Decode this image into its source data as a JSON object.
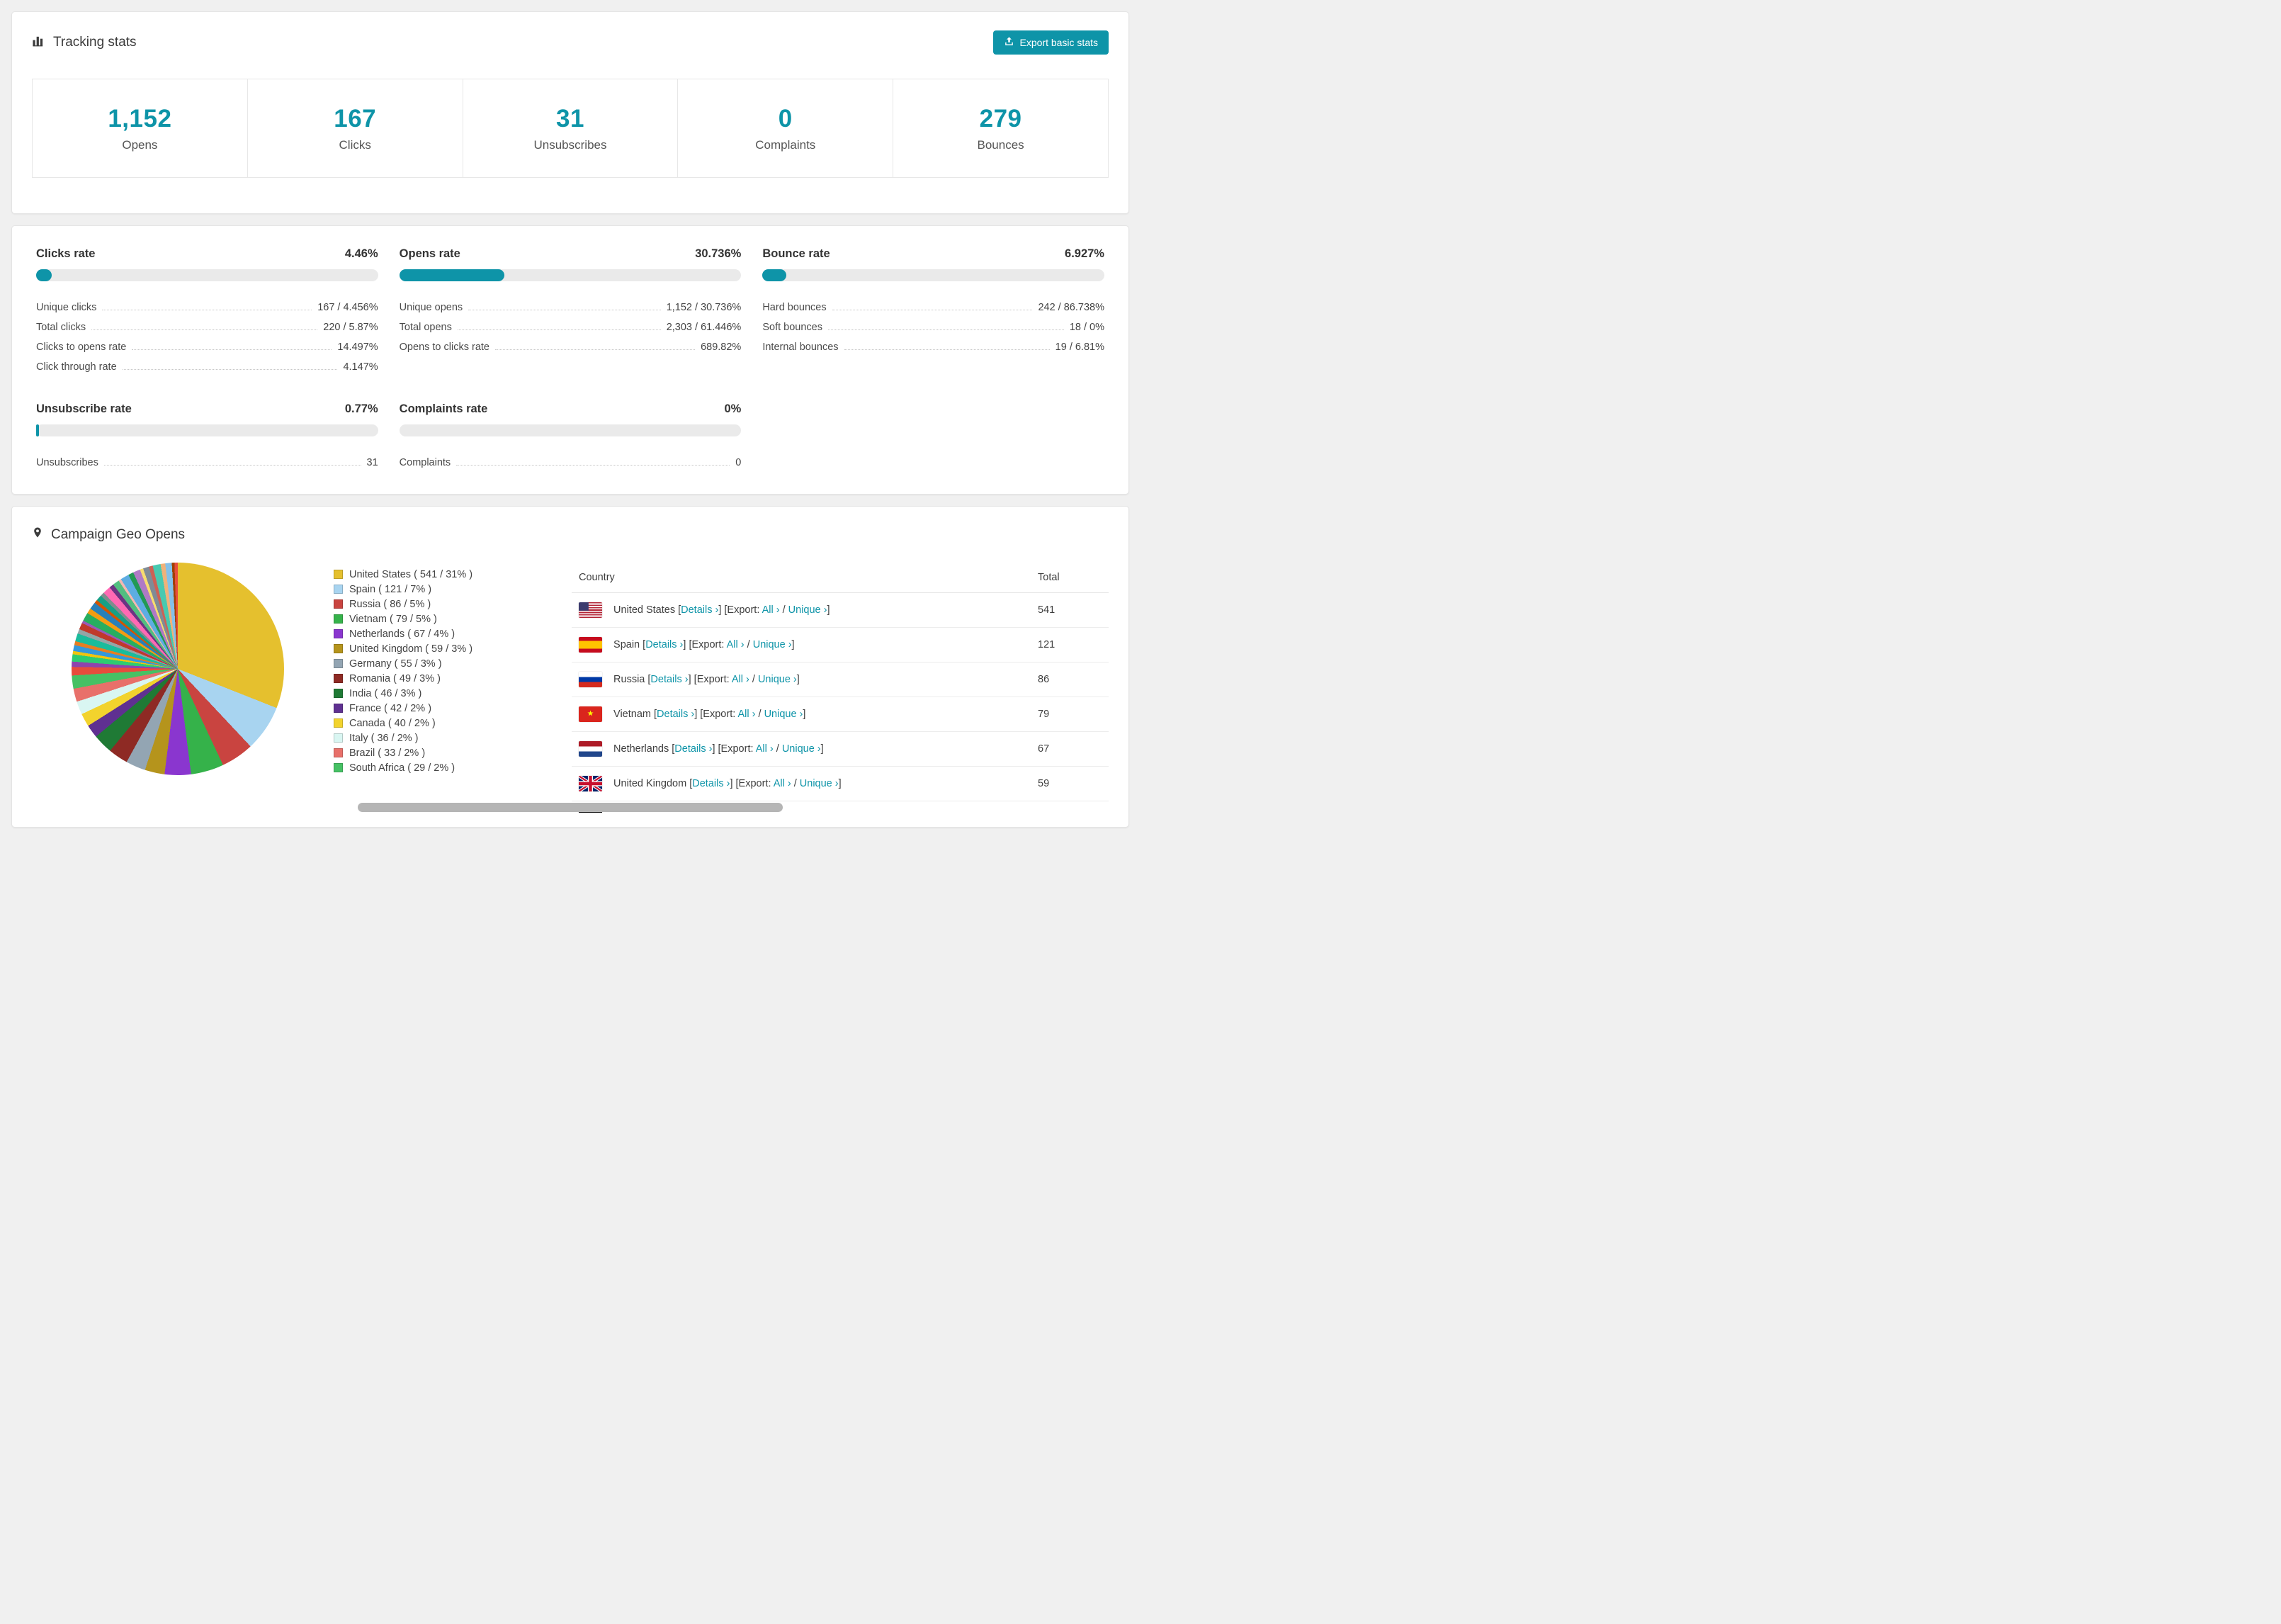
{
  "accent": "#0e94a8",
  "icons": {
    "tracking": "bar-chart",
    "export": "export-arrow-tray",
    "geo": "map-pin"
  },
  "tracking": {
    "title": "Tracking stats",
    "export_button": "Export basic stats",
    "stats": [
      {
        "value": "1,152",
        "label": "Opens"
      },
      {
        "value": "167",
        "label": "Clicks"
      },
      {
        "value": "31",
        "label": "Unsubscribes"
      },
      {
        "value": "0",
        "label": "Complaints"
      },
      {
        "value": "279",
        "label": "Bounces"
      }
    ]
  },
  "rates": [
    {
      "title": "Clicks rate",
      "percent_label": "4.46%",
      "percent": 4.46,
      "rows": [
        {
          "label": "Unique clicks",
          "value": "167 / 4.456%"
        },
        {
          "label": "Total clicks",
          "value": "220 / 5.87%"
        },
        {
          "label": "Clicks to opens rate",
          "value": "14.497%"
        },
        {
          "label": "Click through rate",
          "value": "4.147%"
        }
      ]
    },
    {
      "title": "Opens rate",
      "percent_label": "30.736%",
      "percent": 30.736,
      "rows": [
        {
          "label": "Unique opens",
          "value": "1,152 / 30.736%"
        },
        {
          "label": "Total opens",
          "value": "2,303 / 61.446%"
        },
        {
          "label": "Opens to clicks rate",
          "value": "689.82%"
        }
      ]
    },
    {
      "title": "Bounce rate",
      "percent_label": "6.927%",
      "percent": 6.927,
      "rows": [
        {
          "label": "Hard bounces",
          "value": "242 / 86.738%"
        },
        {
          "label": "Soft bounces",
          "value": "18 / 0%"
        },
        {
          "label": "Internal bounces",
          "value": "19 / 6.81%"
        }
      ]
    },
    {
      "title": "Unsubscribe rate",
      "percent_label": "0.77%",
      "percent": 0.77,
      "rows": [
        {
          "label": "Unsubscribes",
          "value": "31"
        }
      ]
    },
    {
      "title": "Complaints rate",
      "percent_label": "0%",
      "percent": 0,
      "rows": [
        {
          "label": "Complaints",
          "value": "0"
        }
      ]
    }
  ],
  "geo": {
    "title": "Campaign Geo Opens",
    "table": {
      "country_header": "Country",
      "total_header": "Total",
      "bracket_open": "[",
      "bracket_close": "]",
      "details_label": "Details ›",
      "export_label": "Export: ",
      "all_label": "All ›",
      "slash": " / ",
      "unique_label": "Unique ›",
      "partial_next_row_visible": true,
      "rows": [
        {
          "country": "United States",
          "total": "541",
          "flag": "us"
        },
        {
          "country": "Spain",
          "total": "121",
          "flag": "es"
        },
        {
          "country": "Russia",
          "total": "86",
          "flag": "ru"
        },
        {
          "country": "Vietnam",
          "total": "79",
          "flag": "vn"
        },
        {
          "country": "Netherlands",
          "total": "67",
          "flag": "nl"
        },
        {
          "country": "United Kingdom",
          "total": "59",
          "flag": "gb"
        }
      ]
    }
  },
  "chart_data": {
    "type": "pie",
    "title": "Campaign Geo Opens",
    "legend_position": "right",
    "legend_format": "{label} ( {value} / {percent}% )",
    "slices": [
      {
        "label": "United States",
        "value": 541,
        "percent": 31,
        "color": "#e5c02e"
      },
      {
        "label": "Spain",
        "value": 121,
        "percent": 7,
        "color": "#a8d4f0"
      },
      {
        "label": "Russia",
        "value": 86,
        "percent": 5,
        "color": "#c94440"
      },
      {
        "label": "Vietnam",
        "value": 79,
        "percent": 5,
        "color": "#35b24a"
      },
      {
        "label": "Netherlands",
        "value": 67,
        "percent": 4,
        "color": "#8a36cf"
      },
      {
        "label": "United Kingdom",
        "value": 59,
        "percent": 3,
        "color": "#b5941c"
      },
      {
        "label": "Germany",
        "value": 55,
        "percent": 3,
        "color": "#93a5b3"
      },
      {
        "label": "Romania",
        "value": 49,
        "percent": 3,
        "color": "#8e2a24"
      },
      {
        "label": "India",
        "value": 46,
        "percent": 3,
        "color": "#1f7a35"
      },
      {
        "label": "France",
        "value": 42,
        "percent": 2,
        "color": "#5f3091"
      },
      {
        "label": "Canada",
        "value": 40,
        "percent": 2,
        "color": "#f2d32d"
      },
      {
        "label": "Italy",
        "value": 36,
        "percent": 2,
        "color": "#d9f6f2"
      },
      {
        "label": "Brazil",
        "value": 33,
        "percent": 2,
        "color": "#e8706a"
      },
      {
        "label": "South Africa",
        "value": 29,
        "percent": 2,
        "color": "#46c164"
      }
    ],
    "others_percent": 26,
    "others_note": "many small unlabeled slices"
  }
}
